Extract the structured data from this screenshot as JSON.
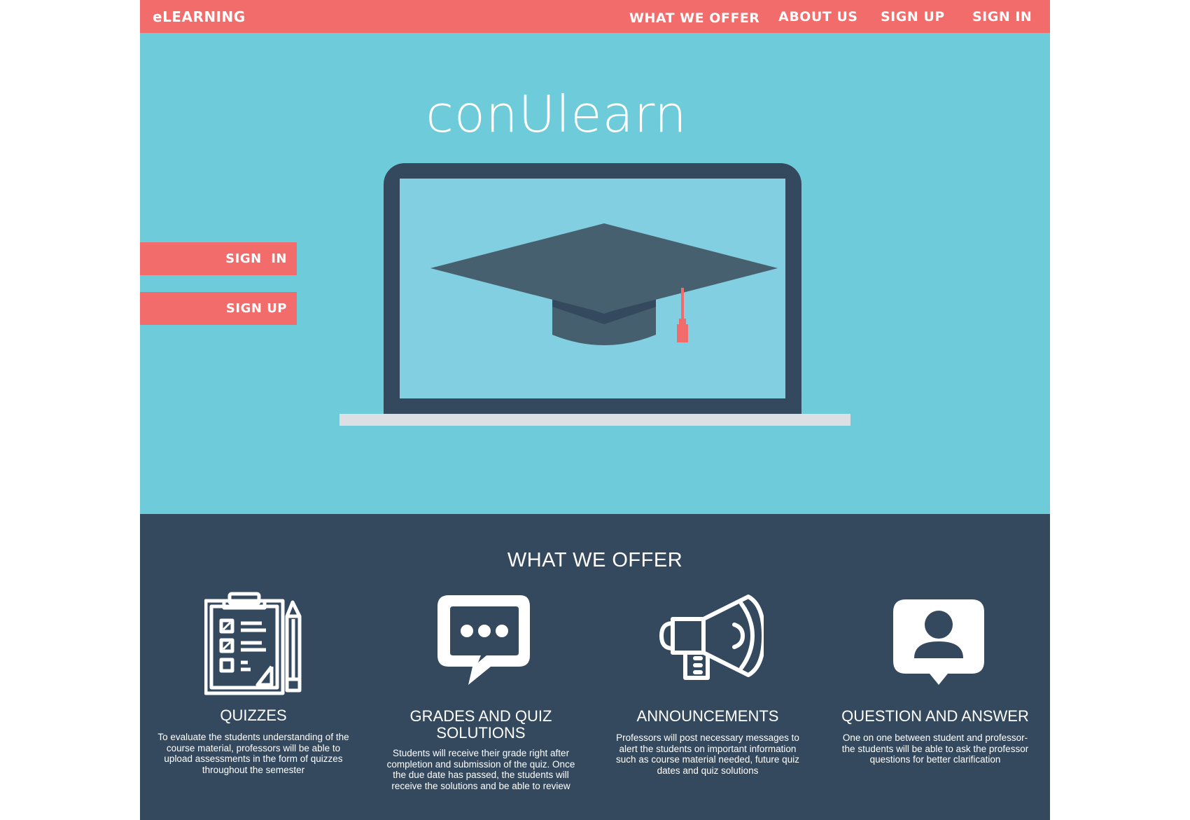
{
  "nav": {
    "brand": "eLEARNING",
    "links": [
      "WHAT WE OFFER",
      "ABOUT US",
      "SIGN UP",
      "SIGN IN"
    ]
  },
  "hero": {
    "title": "conUlearn",
    "sign_in": "SIGN  IN",
    "sign_up": "SIGN UP",
    "illustration": "laptop-graduation-cap"
  },
  "offer": {
    "title": "WHAT WE OFFER",
    "features": [
      {
        "icon": "clipboard-checklist-icon",
        "title": "QUIZZES",
        "description": "To evaluate the students understanding of the course material, professors will be able to upload assessments in the form of quizzes throughout the semester"
      },
      {
        "icon": "chat-bubble-icon",
        "title": "GRADES AND QUIZ SOLUTIONS",
        "description": "Students will receive their grade right after completion and submission of the quiz. Once the due date has passed, the students will receive the solutions and be able to review"
      },
      {
        "icon": "megaphone-icon",
        "title": "ANNOUNCEMENTS",
        "description": "Professors will post necessary messages to alert the students on important information such as course material needed, future quiz dates and quiz solutions"
      },
      {
        "icon": "user-speech-icon",
        "title": "QUESTION AND ANSWER",
        "description": "One on one between student and professor-the students will be able to ask the professor questions for better clarification"
      }
    ]
  },
  "colors": {
    "accent": "#f26c6b",
    "hero_bg": "#6ecbd9",
    "dark": "#34495e",
    "screen": "#81cfe0"
  }
}
